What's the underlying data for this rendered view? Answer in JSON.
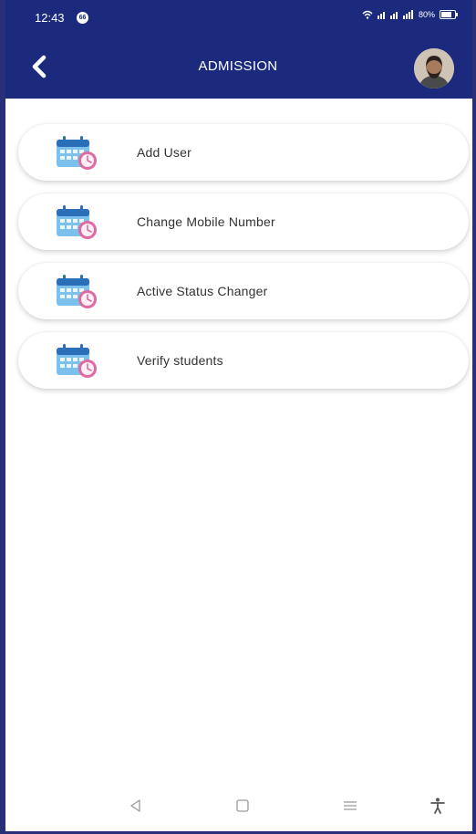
{
  "statusbar": {
    "time": "12:43",
    "badge": "66",
    "network": "≡ டஇ இஇ .ɪ| .ɪ|",
    "battery": "80%"
  },
  "appbar": {
    "title": "ADMISSION",
    "back_icon": "chevron-left-icon",
    "avatar_icon": "user-avatar",
    "color": "#1b2a7d"
  },
  "menu": {
    "items": [
      {
        "label": "Add User",
        "icon": "calendar-clock-icon"
      },
      {
        "label": "Change Mobile Number",
        "icon": "calendar-clock-icon"
      },
      {
        "label": "Active Status Changer",
        "icon": "calendar-clock-icon"
      },
      {
        "label": "Verify students",
        "icon": "calendar-clock-icon"
      }
    ]
  },
  "navbar": {
    "buttons": [
      "back-triangle-icon",
      "home-square-icon",
      "recents-menu-icon",
      "accessibility-icon"
    ]
  }
}
